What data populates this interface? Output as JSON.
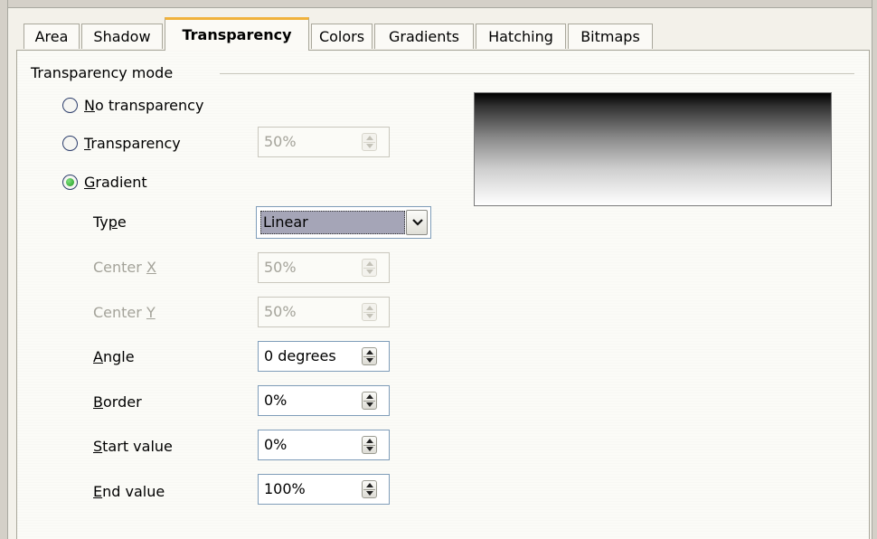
{
  "tabs": [
    {
      "label": "Area",
      "active": false
    },
    {
      "label": "Shadow",
      "active": false
    },
    {
      "label": "Transparency",
      "active": true
    },
    {
      "label": "Colors",
      "active": false
    },
    {
      "label": "Gradients",
      "active": false
    },
    {
      "label": "Hatching",
      "active": false
    },
    {
      "label": "Bitmaps",
      "active": false
    }
  ],
  "group": {
    "label": "Transparency mode"
  },
  "modes": {
    "no_transparency": {
      "mnemonic": "N",
      "rest": "o transparency",
      "checked": false
    },
    "transparency": {
      "mnemonic": "T",
      "rest": "ransparency",
      "checked": false,
      "value": "50%"
    },
    "gradient": {
      "mnemonic": "G",
      "rest": "radient",
      "checked": true
    }
  },
  "fields": {
    "type": {
      "pre": "Ty",
      "mnemonic": "p",
      "post": "e",
      "value": "Linear"
    },
    "center_x": {
      "pre": "Center ",
      "mnemonic": "X",
      "post": "",
      "value": "50%",
      "disabled": true
    },
    "center_y": {
      "pre": "Center ",
      "mnemonic": "Y",
      "post": "",
      "value": "50%",
      "disabled": true
    },
    "angle": {
      "pre": "",
      "mnemonic": "A",
      "post": "ngle",
      "value": "0 degrees"
    },
    "border": {
      "pre": "",
      "mnemonic": "B",
      "post": "order",
      "value": "0%"
    },
    "start_value": {
      "pre": "",
      "mnemonic": "S",
      "post": "tart value",
      "value": "0%"
    },
    "end_value": {
      "pre": "",
      "mnemonic": "E",
      "post": "nd value",
      "value": "100%"
    }
  },
  "colors": {
    "active_tab_accent": "#f0b23c",
    "radio_checked": "#1f9a1f",
    "selection": "#a5a5b7"
  },
  "icons": {
    "spin": "up-down-spin-arrows",
    "dropdown": "chevron-down-icon"
  }
}
